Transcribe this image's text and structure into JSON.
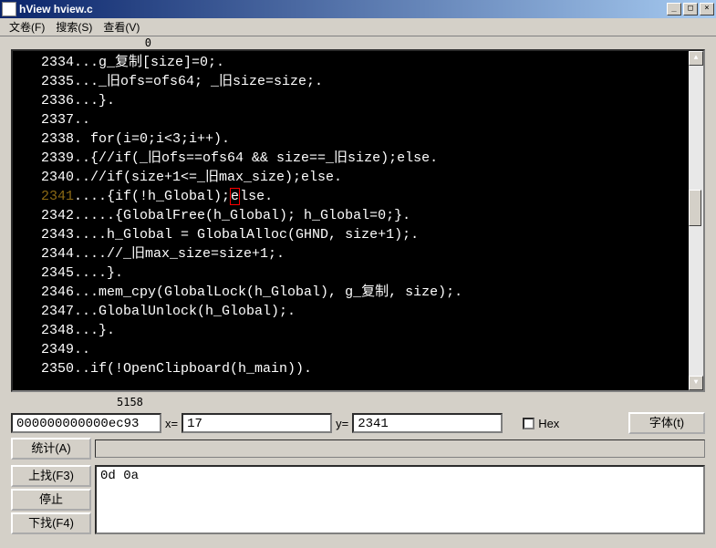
{
  "window": {
    "title": "hView hview.c"
  },
  "menu": {
    "file": "文卷(F)",
    "search": "搜索(S)",
    "view": "查看(V)"
  },
  "editor": {
    "top_value": "0",
    "bottom_value": "5158",
    "lines": [
      {
        "no": "2334",
        "text": "...g_复制[size]=0;."
      },
      {
        "no": "2335",
        "text": "..._旧ofs=ofs64; _旧size=size;."
      },
      {
        "no": "2336",
        "text": "...}."
      },
      {
        "no": "2337",
        "text": ".."
      },
      {
        "no": "2338",
        "text": ". for(i=0;i<3;i++)."
      },
      {
        "no": "2339",
        "text": "..{//if(_旧ofs==ofs64 && size==_旧size);else."
      },
      {
        "no": "2340",
        "text": "..//if(size+1<=_旧max_size);else."
      },
      {
        "no": "2341",
        "text": "....{if(!h_Global);else.",
        "current": true,
        "cursor_at": 19
      },
      {
        "no": "2342",
        "text": ".....{GlobalFree(h_Global); h_Global=0;}."
      },
      {
        "no": "2343",
        "text": "....h_Global = GlobalAlloc(GHND, size+1);."
      },
      {
        "no": "2344",
        "text": "....//_旧max_size=size+1;."
      },
      {
        "no": "2345",
        "text": "....}."
      },
      {
        "no": "2346",
        "text": "...mem_cpy(GlobalLock(h_Global), g_复制, size);."
      },
      {
        "no": "2347",
        "text": "...GlobalUnlock(h_Global);."
      },
      {
        "no": "2348",
        "text": "...}."
      },
      {
        "no": "2349",
        "text": ".."
      },
      {
        "no": "2350",
        "text": "..if(!OpenClipboard(h_main))."
      }
    ]
  },
  "status": {
    "offset": "000000000000ec93",
    "x_label": "x=",
    "x_value": "17",
    "y_label": "y=",
    "y_value": "2341",
    "hex_label": "Hex",
    "font_button": "字体(t)"
  },
  "controls": {
    "stat_button": "统计(A)",
    "find_up": "上找(F3)",
    "stop": "停止",
    "find_down": "下找(F4)",
    "search_text": "0d 0a"
  }
}
